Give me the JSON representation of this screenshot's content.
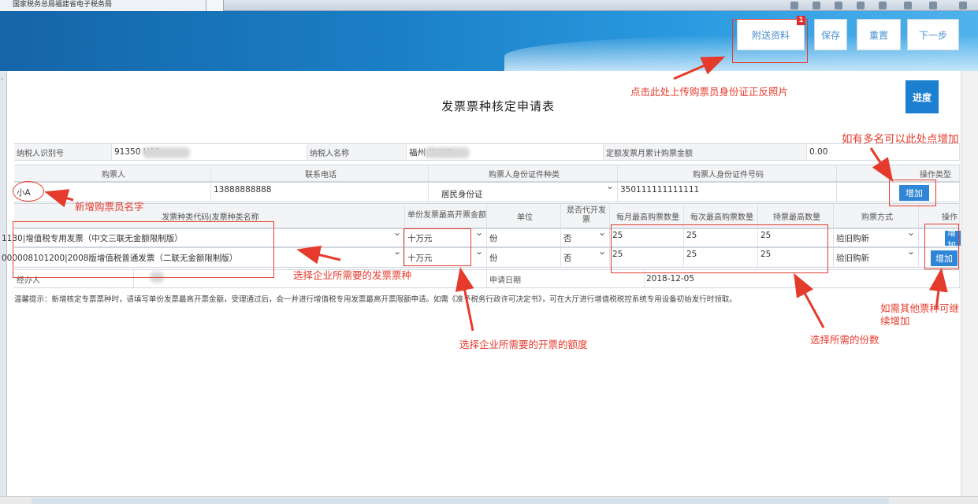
{
  "window": {
    "tab_title": "国家税务总局福建省电子税务局"
  },
  "header": {
    "attach_label": "附送资料",
    "attach_badge": "1",
    "save_label": "保存",
    "reset_label": "重置",
    "next_label": "下一步"
  },
  "page": {
    "title": "发票票种核定申请表",
    "progress_label": "进度"
  },
  "taxpayer": {
    "id_label": "纳税人识别号",
    "id_value": "91350        U00",
    "name_label": "纳税人名称",
    "name_value": "福州       限公司",
    "quota_label": "定额发票月累计购票金额",
    "quota_value": "0.00"
  },
  "buyer_headers": {
    "buyer": "购票人",
    "phone": "联系电话",
    "id_type": "购票人身份证件种类",
    "id_no": "购票人身份证件号码",
    "op_type": "操作类型"
  },
  "buyer": {
    "name": "小A",
    "phone": "13888888888",
    "id_type": "居民身份证",
    "id_no": "350111111111111",
    "add_label": "增加"
  },
  "invoice_headers": {
    "code_name": "发票种类代码|发票种类名称",
    "max_amount": "单份发票最高开票金额",
    "unit": "单位",
    "agent": "是否代开发票",
    "monthly": "每月最高购票数量",
    "each": "每次最高购票数量",
    "hold": "持票最高数量",
    "method": "购票方式",
    "op": "操作"
  },
  "invoices": [
    {
      "code_name": "1130|增值税专用发票（中文三联无金额限制版）",
      "max_amount": "十万元",
      "unit": "份",
      "agent": "否",
      "monthly": "25",
      "each": "25",
      "hold": "25",
      "method": "验旧购新",
      "op": "增加"
    },
    {
      "code_name": "000008101200|2008版增值税普通发票（二联无金额限制版）",
      "max_amount": "十万元",
      "unit": "份",
      "agent": "否",
      "monthly": "25",
      "each": "25",
      "hold": "25",
      "method": "验旧购新",
      "op": "增加"
    }
  ],
  "footer_row": {
    "handler_label": "经办人",
    "date_label": "申请日期",
    "date_value": "2018-12-05"
  },
  "tip": "温馨提示：新增核定专票票种时，请填写单份发票最高开票金额，受理通过后，会一并进行增值税专用发票最高开票限额申请。如需《准予税务行政许可决定书》，可在大厅进行增值税税控系统专用设备初始发行时领取。",
  "annotations": {
    "upload": "点击此处上传购票员身份证正反照片",
    "add_more": "如有多名可以此处点增加",
    "new_buyer": "新增购票员名字",
    "select_type": "选择企业所需要的发票票种",
    "select_amount": "选择企业所需要的开票的额度",
    "select_count": "选择所需的份数",
    "add_other_1": "如需其他票种可继",
    "add_other_2": "续增加"
  },
  "colors": {
    "header_blue": "#1b7fc6",
    "button_blue": "#2f86d6",
    "annotation_red": "#e53b2c"
  }
}
